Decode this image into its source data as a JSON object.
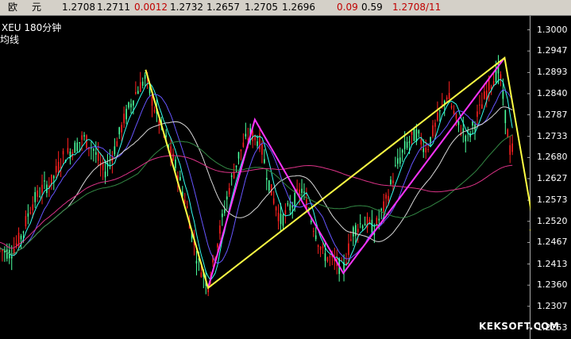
{
  "header": {
    "name1": "欧",
    "name2": "元",
    "open": "1.2708",
    "prev": "1.2711",
    "change": "0.0012",
    "high": "1.2732",
    "low": "1.2657",
    "last": "1.2705",
    "avg": "1.2696",
    "pct": "0.09",
    "vol": "0.59",
    "date": "1.2708/11"
  },
  "symbol_label": "XEU  180分钟",
  "ma_label": "均线",
  "watermark": "KEKSOFT.COM",
  "colors": {
    "up": "#ff2020",
    "down": "#4cff9e",
    "zigzag_yellow": "#ffff44",
    "zigzag_magenta": "#ff33ff",
    "ma_cyan": "#33ffee",
    "ma_blue": "#6655ff",
    "ma_white": "#d8d8d8",
    "ma_green": "#338844",
    "ma_pink": "#dd3388"
  },
  "chart_data": {
    "type": "candlestick",
    "y_ticks": [
      "1.3000",
      "1.2947",
      "1.2893",
      "1.2840",
      "1.2787",
      "1.2733",
      "1.2680",
      "1.2627",
      "1.2573",
      "1.2520",
      "1.2467",
      "1.2413",
      "1.2360",
      "1.2307",
      "1.2253"
    ],
    "ylim": [
      1.2225,
      1.3035
    ],
    "yellow_zigzag": [
      {
        "bar": 0.28,
        "price": 1.29
      },
      {
        "bar": 0.4,
        "price": 1.2353
      },
      {
        "bar": 0.97,
        "price": 1.293
      },
      {
        "bar": 1.03,
        "price": 1.248
      }
    ],
    "magenta_zigzag": [
      {
        "bar": 0.4,
        "price": 1.2353
      },
      {
        "bar": 0.49,
        "price": 1.2775
      },
      {
        "bar": 0.66,
        "price": 1.239
      },
      {
        "bar": 0.97,
        "price": 1.293
      }
    ],
    "price_path": [
      [
        0.0,
        1.245
      ],
      [
        0.02,
        1.244
      ],
      [
        0.04,
        1.248
      ],
      [
        0.06,
        1.256
      ],
      [
        0.08,
        1.26
      ],
      [
        0.1,
        1.262
      ],
      [
        0.12,
        1.268
      ],
      [
        0.14,
        1.27
      ],
      [
        0.16,
        1.273
      ],
      [
        0.18,
        1.27
      ],
      [
        0.2,
        1.264
      ],
      [
        0.22,
        1.27
      ],
      [
        0.24,
        1.278
      ],
      [
        0.26,
        1.284
      ],
      [
        0.28,
        1.288
      ],
      [
        0.3,
        1.279
      ],
      [
        0.32,
        1.272
      ],
      [
        0.34,
        1.265
      ],
      [
        0.36,
        1.255
      ],
      [
        0.38,
        1.242
      ],
      [
        0.4,
        1.236
      ],
      [
        0.42,
        1.248
      ],
      [
        0.44,
        1.26
      ],
      [
        0.46,
        1.269
      ],
      [
        0.48,
        1.274
      ],
      [
        0.5,
        1.272
      ],
      [
        0.52,
        1.26
      ],
      [
        0.54,
        1.252
      ],
      [
        0.56,
        1.256
      ],
      [
        0.58,
        1.26
      ],
      [
        0.6,
        1.252
      ],
      [
        0.62,
        1.244
      ],
      [
        0.64,
        1.242
      ],
      [
        0.66,
        1.24
      ],
      [
        0.68,
        1.25
      ],
      [
        0.7,
        1.252
      ],
      [
        0.72,
        1.25
      ],
      [
        0.74,
        1.256
      ],
      [
        0.76,
        1.265
      ],
      [
        0.78,
        1.271
      ],
      [
        0.8,
        1.274
      ],
      [
        0.82,
        1.27
      ],
      [
        0.84,
        1.277
      ],
      [
        0.86,
        1.284
      ],
      [
        0.88,
        1.276
      ],
      [
        0.9,
        1.273
      ],
      [
        0.92,
        1.279
      ],
      [
        0.94,
        1.286
      ],
      [
        0.96,
        1.29
      ],
      [
        0.98,
        1.27
      ]
    ]
  }
}
